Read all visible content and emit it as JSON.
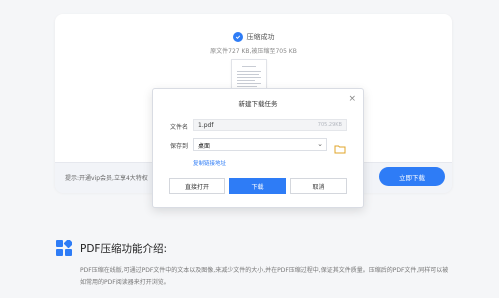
{
  "compress": {
    "success_label": "压缩成功",
    "size_info": "原文件727 KB,被压缩至705 KB"
  },
  "bottom_bar": {
    "vip_tip": "提示:开通vip会员,立享4大特权",
    "download_now": "立即下载"
  },
  "modal": {
    "title": "新建下载任务",
    "close_symbol": "×",
    "filename_label": "文件名",
    "filename_value": "1.pdf",
    "filesize_value": "705.29KB",
    "saveto_label": "保存到",
    "saveto_value": "桌面",
    "copy_link": "复制链接地址",
    "buttons": {
      "open_directly": "直接打开",
      "download": "下载",
      "cancel": "取消"
    }
  },
  "intro": {
    "title": "PDF压缩功能介绍:",
    "text": "PDF压缩在线版,可通过PDF文件中的文本以及图像,来减少文件的大小,并在PDF压缩过程中,保证其文件质量。压缩后的PDF文件,同样可以被如常用的PDF阅读器来打开浏览。"
  },
  "colors": {
    "accent": "#2e7cf6",
    "background": "#f5f6f8"
  }
}
